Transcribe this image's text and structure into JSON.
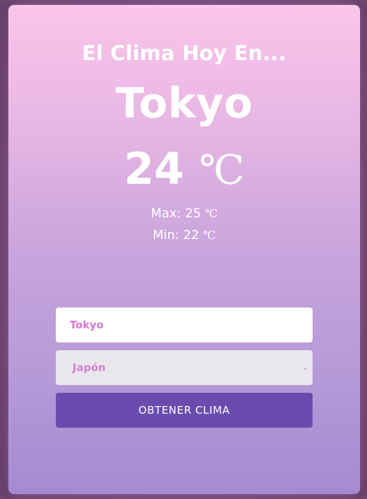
{
  "header": {
    "title": "El Clima Hoy En...",
    "city": "Tokyo"
  },
  "current": {
    "temp": "24",
    "unit": "℃"
  },
  "range": {
    "max_label": "Max: 25",
    "min_label": "Min: 22",
    "unit": "℃"
  },
  "form": {
    "city_value": "Tokyo",
    "country_selected": "Japón",
    "submit_label": "OBTENER CLIMA"
  },
  "colors": {
    "accent": "#6a4caf",
    "text_accent": "#d478d4"
  },
  "icons": {
    "select_arrow": "chevron-down-icon"
  }
}
